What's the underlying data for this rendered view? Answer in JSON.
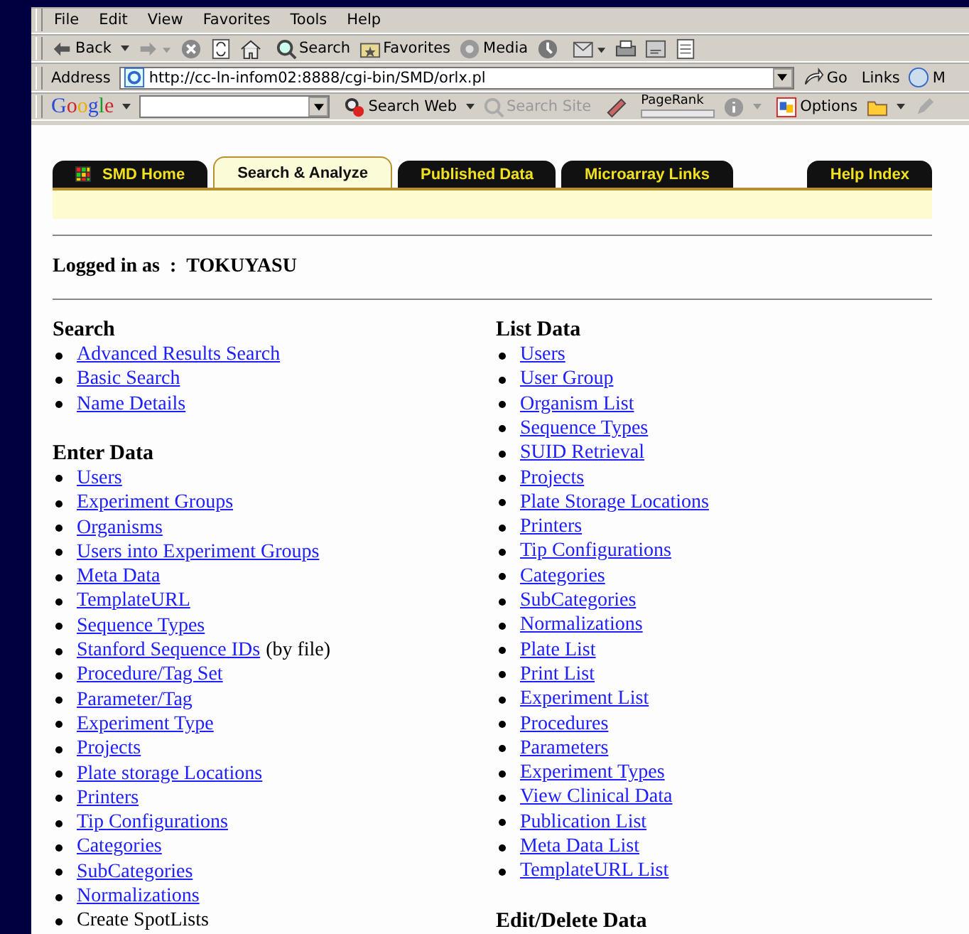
{
  "menu": [
    "File",
    "Edit",
    "View",
    "Favorites",
    "Tools",
    "Help"
  ],
  "toolbar": [
    {
      "kind": "back",
      "label": "Back"
    },
    {
      "kind": "forward"
    },
    {
      "kind": "stop"
    },
    {
      "kind": "refresh"
    },
    {
      "kind": "home"
    },
    {
      "kind": "search",
      "label": "Search"
    },
    {
      "kind": "favorites",
      "label": "Favorites"
    },
    {
      "kind": "media",
      "label": "Media"
    },
    {
      "kind": "history"
    },
    {
      "kind": "mail"
    },
    {
      "kind": "print"
    },
    {
      "kind": "edit"
    },
    {
      "kind": "discuss"
    }
  ],
  "address": {
    "label": "Address",
    "url": "http://cc-ln-infom02:8888/cgi-bin/SMD/orlx.pl",
    "go": "Go",
    "links": "Links",
    "cut_link": "M"
  },
  "google_bar": {
    "logo": "Google",
    "search_web": "Search Web",
    "search_site": {
      "label": "Search Site",
      "disabled": true
    },
    "pagerank": "PageRank",
    "options": "Options"
  },
  "tabs": [
    {
      "label": "SMD Home",
      "selected": false,
      "kind": "home"
    },
    {
      "label": "Search & Analyze",
      "selected": true
    },
    {
      "label": "Published Data",
      "selected": false
    },
    {
      "label": "Microarray Links",
      "selected": false
    },
    {
      "label": "Help Index",
      "selected": false,
      "kind": "right"
    }
  ],
  "login": {
    "label": "Logged in as",
    "sep": ":",
    "user": "TOKUYASU"
  },
  "columns": [
    [
      {
        "title": "Search",
        "items": [
          {
            "kind": "link",
            "text": "Advanced Results Search"
          },
          {
            "kind": "link",
            "text": "Basic Search"
          },
          {
            "kind": "link",
            "text": "Name Details"
          }
        ]
      },
      {
        "title": "Enter Data",
        "items": [
          {
            "kind": "link",
            "text": "Users"
          },
          {
            "kind": "link",
            "text": "Experiment Groups"
          },
          {
            "kind": "link",
            "text": "Organisms"
          },
          {
            "kind": "link",
            "text": "Users into Experiment Groups"
          },
          {
            "kind": "link",
            "text": "Meta Data"
          },
          {
            "kind": "link",
            "text": "TemplateURL"
          },
          {
            "kind": "link",
            "text": "Sequence Types"
          },
          {
            "kind": "link",
            "text": "Stanford Sequence IDs",
            "suffix": "(by file)"
          },
          {
            "kind": "link",
            "text": "Procedure/Tag Set"
          },
          {
            "kind": "link",
            "text": "Parameter/Tag"
          },
          {
            "kind": "link",
            "text": "Experiment Type"
          },
          {
            "kind": "link",
            "text": "Projects"
          },
          {
            "kind": "link",
            "text": "Plate storage Locations"
          },
          {
            "kind": "link",
            "text": "Printers"
          },
          {
            "kind": "link",
            "text": "Tip Configurations"
          },
          {
            "kind": "link",
            "text": "Categories"
          },
          {
            "kind": "link",
            "text": "SubCategories"
          },
          {
            "kind": "link",
            "text": "Normalizations"
          },
          {
            "kind": "text",
            "text": "Create SpotLists"
          }
        ]
      }
    ],
    [
      {
        "title": "List Data",
        "items": [
          {
            "kind": "link",
            "text": "Users"
          },
          {
            "kind": "link",
            "text": "User Group"
          },
          {
            "kind": "link",
            "text": "Organism List"
          },
          {
            "kind": "link",
            "text": "Sequence Types"
          },
          {
            "kind": "link",
            "text": "SUID Retrieval"
          },
          {
            "kind": "link",
            "text": "Projects"
          },
          {
            "kind": "link",
            "text": "Plate Storage Locations"
          },
          {
            "kind": "link",
            "text": "Printers"
          },
          {
            "kind": "link",
            "text": "Tip Configurations"
          },
          {
            "kind": "link",
            "text": "Categories"
          },
          {
            "kind": "link",
            "text": "SubCategories"
          },
          {
            "kind": "link",
            "text": "Normalizations"
          },
          {
            "kind": "link",
            "text": "Plate List"
          },
          {
            "kind": "link",
            "text": "Print List"
          },
          {
            "kind": "link",
            "text": "Experiment List"
          },
          {
            "kind": "link",
            "text": "Procedures"
          },
          {
            "kind": "link",
            "text": "Parameters"
          },
          {
            "kind": "link",
            "text": "Experiment Types"
          },
          {
            "kind": "link",
            "text": "View Clinical Data"
          },
          {
            "kind": "link",
            "text": "Publication List"
          },
          {
            "kind": "link",
            "text": "Meta Data List"
          },
          {
            "kind": "link",
            "text": "TemplateURL List"
          }
        ]
      },
      {
        "title": "Edit/Delete Data"
      }
    ]
  ]
}
